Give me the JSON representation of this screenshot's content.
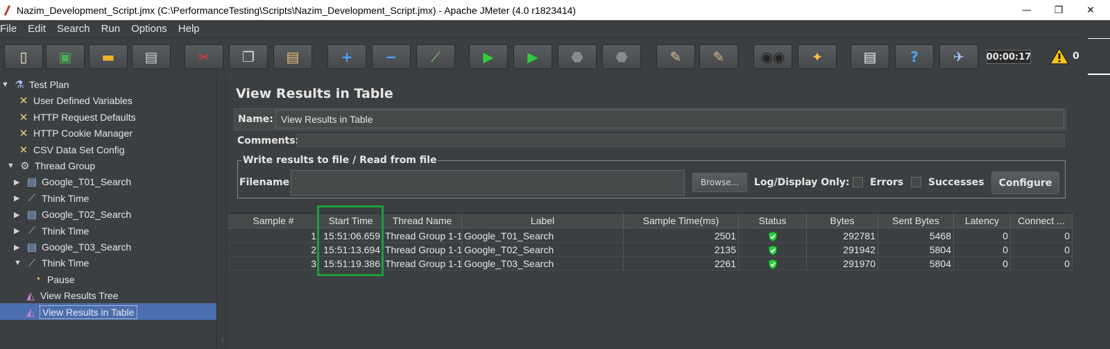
{
  "window": {
    "title": "Nazim_Development_Script.jmx (C:\\PerformanceTesting\\Scripts\\Nazim_Development_Script.jmx) - Apache JMeter (4.0 r1823414)",
    "minimize": "—",
    "restore": "❐",
    "close": "✕"
  },
  "menu": [
    "File",
    "Edit",
    "Search",
    "Run",
    "Options",
    "Help"
  ],
  "toolbar": {
    "icons": [
      "new-icon",
      "templates-icon",
      "open-icon",
      "save-icon",
      "cut-icon",
      "copy-icon",
      "paste-icon",
      "expand-icon",
      "collapse-icon",
      "toggle-icon",
      "start-icon",
      "start-no-timers-icon",
      "stop-icon",
      "shutdown-icon",
      "clear-icon",
      "clear-all-icon",
      "search-icon",
      "reset-search-icon",
      "function-helper-icon",
      "help-icon",
      "remote-icon"
    ],
    "timer": "00:00:17",
    "warning_count": "0"
  },
  "tree": [
    {
      "label": "Test Plan",
      "icon": "flask-icon",
      "level": 0,
      "arrow": "▼"
    },
    {
      "label": "User Defined Variables",
      "icon": "wrench-icon",
      "level": 1,
      "arrow": ""
    },
    {
      "label": "HTTP Request Defaults",
      "icon": "wrench-icon",
      "level": 1,
      "arrow": ""
    },
    {
      "label": "HTTP Cookie Manager",
      "icon": "wrench-icon",
      "level": 1,
      "arrow": ""
    },
    {
      "label": "CSV Data Set Config",
      "icon": "wrench-icon",
      "level": 1,
      "arrow": ""
    },
    {
      "label": "Thread Group",
      "icon": "gear-icon",
      "level": 1,
      "arrow": "▼"
    },
    {
      "label": "Google_T01_Search",
      "icon": "sampler-icon",
      "level": 2,
      "arrow": "▶"
    },
    {
      "label": "Think Time",
      "icon": "pipette-icon",
      "level": 2,
      "arrow": "▶"
    },
    {
      "label": "Google_T02_Search",
      "icon": "sampler-icon",
      "level": 2,
      "arrow": "▶"
    },
    {
      "label": "Think Time",
      "icon": "pipette-icon",
      "level": 2,
      "arrow": "▶"
    },
    {
      "label": "Google_T03_Search",
      "icon": "sampler-icon",
      "level": 2,
      "arrow": "▶"
    },
    {
      "label": "Think Time",
      "icon": "pipette-icon",
      "level": 2,
      "arrow": "▼"
    },
    {
      "label": "Pause",
      "icon": "stopwatch-icon",
      "level": 3,
      "arrow": ""
    },
    {
      "label": "View Results Tree",
      "icon": "chart-icon",
      "level": 2,
      "arrow": ""
    },
    {
      "label": "View Results in Table",
      "icon": "chart-icon",
      "level": 2,
      "arrow": "",
      "selected": true
    }
  ],
  "panel": {
    "title": "View Results in Table",
    "name_label": "Name:",
    "name_value": "View Results in Table",
    "comments_label": "Comments:",
    "fileset_legend": "Write results to file / Read from file",
    "filename_label": "Filename",
    "browse_label": "Browse...",
    "logdisplay_label": "Log/Display Only:",
    "errors_label": "Errors",
    "successes_label": "Successes",
    "configure_label": "Configure"
  },
  "table": {
    "columns": [
      "Sample #",
      "Start Time",
      "Thread Name",
      "Label",
      "Sample Time(ms)",
      "Status",
      "Bytes",
      "Sent Bytes",
      "Latency",
      "Connect ..."
    ],
    "rows": [
      [
        "1",
        "15:51:06.659",
        "Thread Group 1-1",
        "Google_T01_Search",
        "2501",
        "success",
        "292781",
        "5468",
        "0",
        "0"
      ],
      [
        "2",
        "15:51:13.694",
        "Thread Group 1-1",
        "Google_T02_Search",
        "2135",
        "success",
        "291942",
        "5804",
        "0",
        "0"
      ],
      [
        "3",
        "15:51:19.386",
        "Thread Group 1-1",
        "Google_T03_Search",
        "2261",
        "success",
        "291970",
        "5804",
        "0",
        "0"
      ]
    ]
  },
  "colors": {
    "background": "#3c3f41",
    "selection": "#4b6eaf",
    "highlight_box": "#1f9e3d",
    "status_ok": "#2ecc40"
  }
}
